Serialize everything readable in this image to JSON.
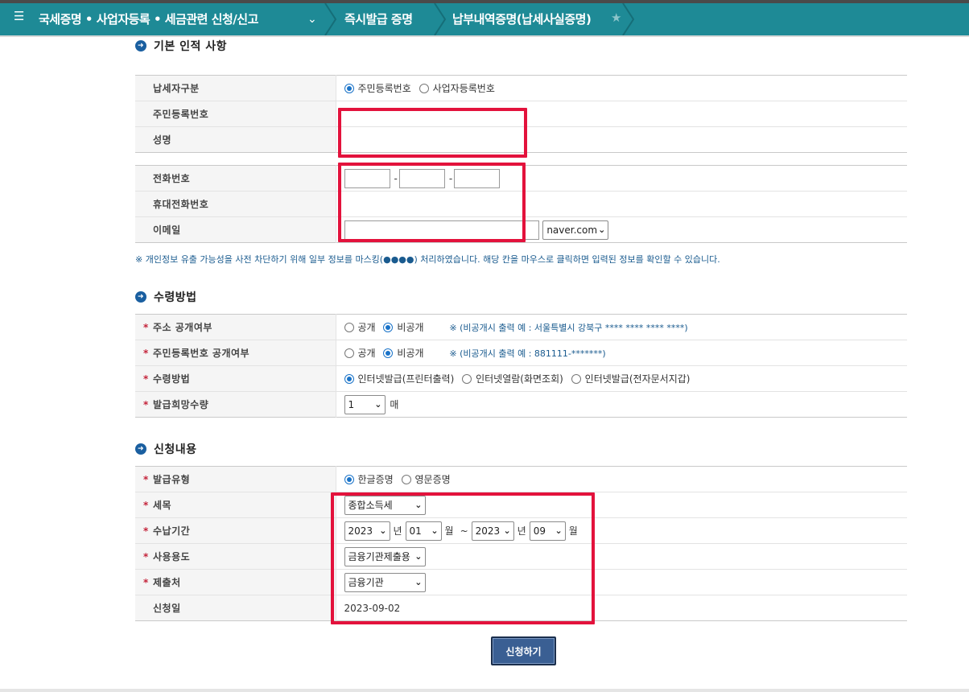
{
  "nav": {
    "menu_icon": "menu-icon",
    "main": "국세증명 • 사업자등록 • 세금관련 신청/신고",
    "crumb2": "즉시발급 증명",
    "crumb3": "납부내역증명(납세사실증명)"
  },
  "basic": {
    "title": "기본 인적 사항",
    "rows": {
      "taxpayer_type": "납세자구분",
      "resident_no": "주민등록번호",
      "name": "성명",
      "phone": "전화번호",
      "mobile": "휴대전화번호",
      "email": "이메일"
    },
    "radio_resident": "주민등록번호",
    "radio_business": "사업자등록번호",
    "phone_sep": "-",
    "email_domain": "naver.com"
  },
  "notice": "※ 개인정보 유출 가능성을 사전 차단하기 위해 일부 정보를 마스킹(●●●●) 처리하였습니다. 해당 칸을 마우스로 클릭하면 입력된 정보를 확인할 수 있습니다.",
  "receive": {
    "title": "수령방법",
    "rows": {
      "address_public": "주소 공개여부",
      "resident_public": "주민등록번호 공개여부",
      "method": "수령방법",
      "copies": "발급희망수량"
    },
    "public": "공개",
    "private": "비공개",
    "address_note": "※ (비공개시 출력 예 : 서울특별시 강북구 **** **** **** ****)",
    "resident_note": "※ (비공개시 출력 예 : 881111-*******)",
    "method_print": "인터넷발급(프린터출력)",
    "method_view": "인터넷열람(화면조회)",
    "method_doc": "인터넷발급(전자문서지갑)",
    "copies_value": "1",
    "copies_unit": "매"
  },
  "apply": {
    "title": "신청내용",
    "rows": {
      "type": "발급유형",
      "tax": "세목",
      "period": "수납기간",
      "purpose": "사용용도",
      "submit_to": "제출처",
      "date": "신청일"
    },
    "type_kor": "한글증명",
    "type_eng": "영문증명",
    "tax_value": "종합소득세",
    "from_year": "2023",
    "from_month": "01",
    "to_year": "2023",
    "to_month": "09",
    "year_unit": "년",
    "month_unit": "월",
    "tilde": "~",
    "purpose_value": "금융기관제출용",
    "submit_value": "금융기관",
    "date_value": "2023-09-02"
  },
  "submit_label": "신청하기",
  "colors": {
    "nav": "#1e8a96",
    "highlight": "#e3123c",
    "button": "#3a5f93"
  }
}
